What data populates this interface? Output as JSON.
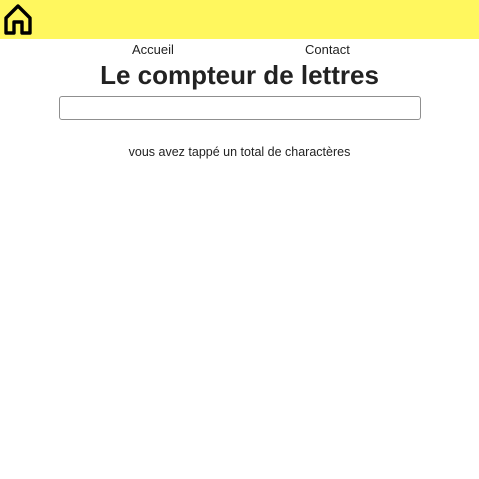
{
  "header": {
    "background_color": "#fff75e",
    "home_icon": "home-icon"
  },
  "nav": {
    "items": [
      {
        "label": "Accueil"
      },
      {
        "label": "Contact"
      }
    ]
  },
  "main": {
    "title": "Le compteur de lettres",
    "input": {
      "value": "",
      "placeholder": ""
    },
    "counter_text": "vous avez tappé un total de charactères"
  }
}
